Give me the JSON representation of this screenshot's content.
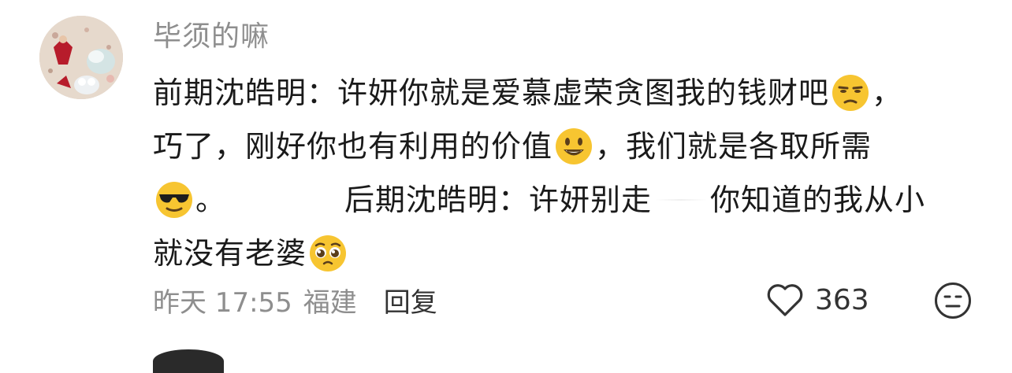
{
  "comment": {
    "username": "毕须的嘛",
    "lines": [
      "前期沈皓明：许妍你就是爱慕虚荣贪图我的钱财吧",
      "，",
      "巧了，刚好你也有利用的价值",
      "，我们就是各取所需",
      "。",
      "后期沈皓明：许妍别走",
      "你知道的我从小",
      "就没有老婆"
    ],
    "time": "昨天 17:55",
    "location": "福建",
    "reply_label": "回复",
    "like_count": "363"
  },
  "icons": {
    "like": "heart-outline-icon",
    "dislike": "neutral-face-icon"
  },
  "colors": {
    "text": "#1a1a1a",
    "muted": "#8e8e8e",
    "emoji_yellow": "#f7c531"
  }
}
